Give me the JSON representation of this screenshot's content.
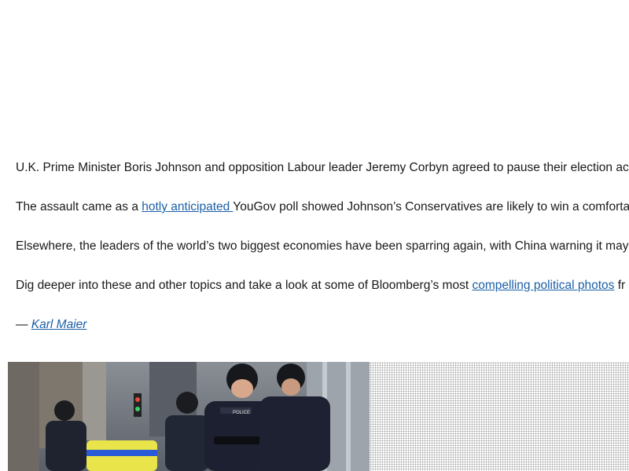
{
  "article": {
    "paragraphs": [
      {
        "text": "U.K. Prime Minister Boris Johnson and opposition Labour leader Jeremy Corbyn agreed to pause their election ac"
      },
      {
        "before": "The assault came as a ",
        "link": "hotly anticipated ",
        "after": "YouGov poll showed Johnson’s Conservatives are likely to win a comforta"
      },
      {
        "text": "Elsewhere, the leaders of the world’s two biggest economies have been sparring again, with China warning it may"
      },
      {
        "before": "Dig deeper into these and other topics and take a look at some of Bloomberg’s most ",
        "link": "compelling political photos",
        "after": " fr"
      }
    ],
    "signoff": {
      "dash": "— ",
      "author": "Karl Maier"
    }
  },
  "photo": {
    "description_icon": "police-officers-photo",
    "badge_text": "POLICE"
  },
  "colors": {
    "link": "#1b5fa8",
    "text": "#1a1a1a"
  }
}
